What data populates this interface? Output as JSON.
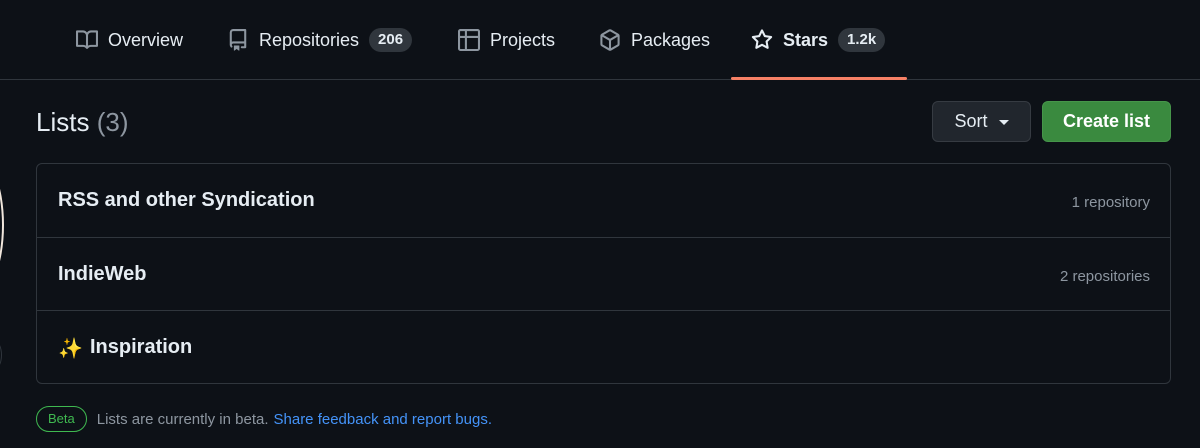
{
  "tabs": {
    "overview": {
      "label": "Overview",
      "icon": "book-icon"
    },
    "repositories": {
      "label": "Repositories",
      "count": "206",
      "icon": "repo-icon"
    },
    "projects": {
      "label": "Projects",
      "icon": "table-icon"
    },
    "packages": {
      "label": "Packages",
      "icon": "package-icon"
    },
    "stars": {
      "label": "Stars",
      "count": "1.2k",
      "icon": "star-icon",
      "active": true
    }
  },
  "lists_header": {
    "title": "Lists",
    "count": "(3)"
  },
  "actions": {
    "sort_label": "Sort",
    "create_label": "Create list"
  },
  "lists": [
    {
      "name": "RSS and other Syndication",
      "repo_count": "1 repository"
    },
    {
      "name": "IndieWeb",
      "repo_count": "2 repositories"
    },
    {
      "name": "Inspiration",
      "emoji": "✨",
      "repo_count": ""
    }
  ],
  "footer": {
    "badge": "Beta",
    "text": "Lists are currently in beta.",
    "link": "Share feedback and report bugs."
  },
  "colors": {
    "background": "#0d1117",
    "border": "#30363d",
    "accent_underline": "#f78166",
    "primary_button": "#3a8a3f",
    "link": "#4493f8",
    "beta": "#3fb950"
  }
}
